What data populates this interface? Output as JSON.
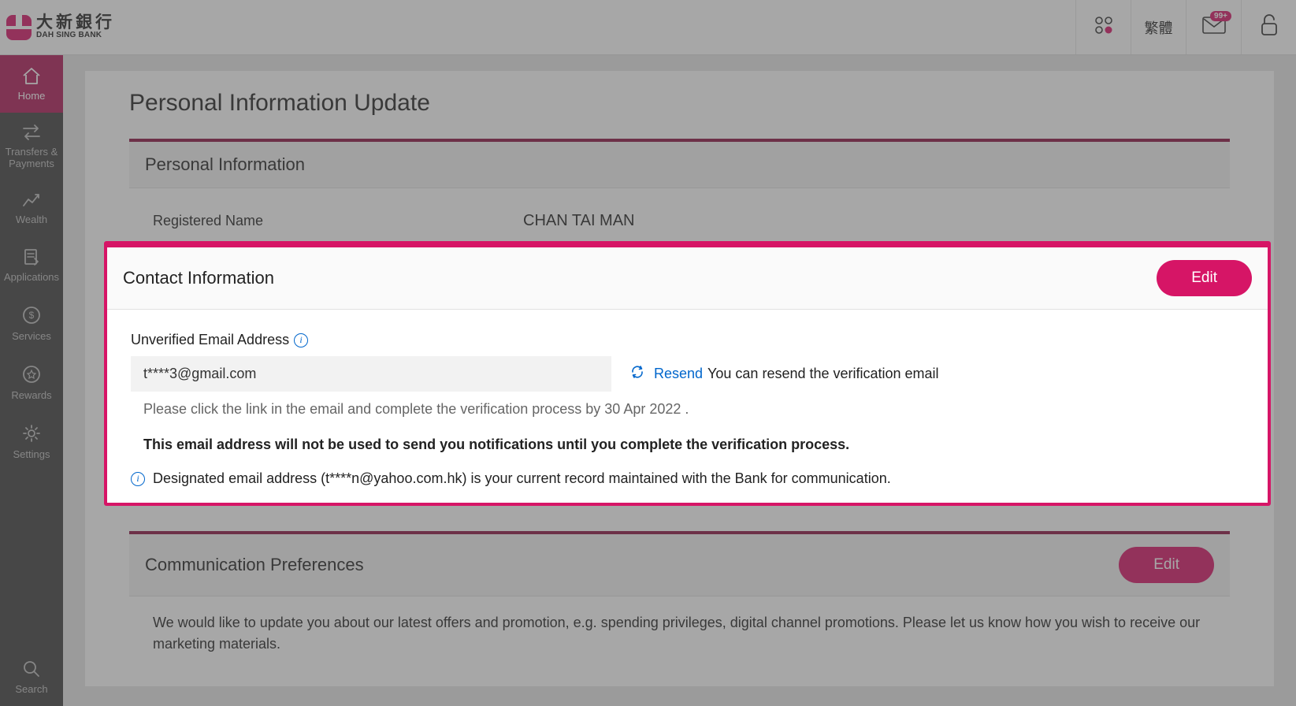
{
  "header": {
    "logo_cn": "大新銀行",
    "logo_en": "DAH SING BANK",
    "lang_label": "繁體",
    "mail_badge": "99+"
  },
  "sidebar": {
    "items": [
      {
        "id": "home",
        "label": "Home"
      },
      {
        "id": "transfers",
        "label": "Transfers & Payments"
      },
      {
        "id": "wealth",
        "label": "Wealth"
      },
      {
        "id": "applications",
        "label": "Applications"
      },
      {
        "id": "services",
        "label": "Services"
      },
      {
        "id": "rewards",
        "label": "Rewards"
      },
      {
        "id": "settings",
        "label": "Settings"
      }
    ],
    "search_label": "Search"
  },
  "page": {
    "title": "Personal Information Update"
  },
  "personal": {
    "section_title": "Personal Information",
    "registered_name_label": "Registered Name",
    "registered_name_value": "CHAN TAI MAN"
  },
  "contact": {
    "section_title": "Contact Information",
    "edit_label": "Edit",
    "unverified_label": "Unverified Email Address",
    "email_value": "t****3@gmail.com",
    "resend_link": "Resend",
    "resend_text": "You can resend the verification email",
    "hint": "Please click the link in the email and complete the verification process by 30 Apr 2022 .",
    "bold_notice": "This email address will not be used to send you notifications until you complete the verification process.",
    "designated_text": "Designated email address (t****n@yahoo.com.hk) is your current record maintained with the Bank for communication."
  },
  "comm": {
    "section_title": "Communication Preferences",
    "edit_label": "Edit",
    "body_text": "We would like to update you about our latest offers and promotion, e.g. spending privileges, digital channel promotions. Please let us know how you wish to receive our marketing materials."
  }
}
